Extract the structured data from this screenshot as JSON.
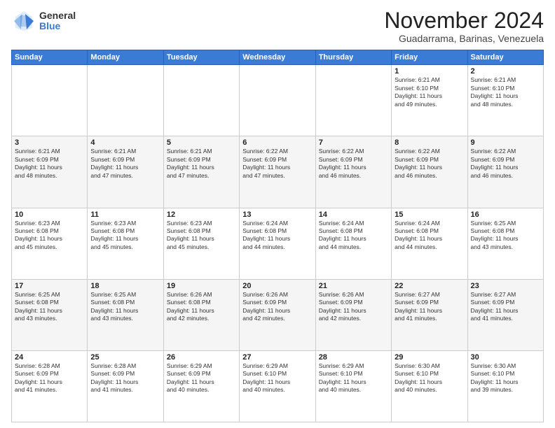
{
  "logo": {
    "general": "General",
    "blue": "Blue"
  },
  "title": "November 2024",
  "location": "Guadarrama, Barinas, Venezuela",
  "days_header": [
    "Sunday",
    "Monday",
    "Tuesday",
    "Wednesday",
    "Thursday",
    "Friday",
    "Saturday"
  ],
  "weeks": [
    [
      {
        "day": "",
        "info": ""
      },
      {
        "day": "",
        "info": ""
      },
      {
        "day": "",
        "info": ""
      },
      {
        "day": "",
        "info": ""
      },
      {
        "day": "",
        "info": ""
      },
      {
        "day": "1",
        "info": "Sunrise: 6:21 AM\nSunset: 6:10 PM\nDaylight: 11 hours\nand 49 minutes."
      },
      {
        "day": "2",
        "info": "Sunrise: 6:21 AM\nSunset: 6:10 PM\nDaylight: 11 hours\nand 48 minutes."
      }
    ],
    [
      {
        "day": "3",
        "info": "Sunrise: 6:21 AM\nSunset: 6:09 PM\nDaylight: 11 hours\nand 48 minutes."
      },
      {
        "day": "4",
        "info": "Sunrise: 6:21 AM\nSunset: 6:09 PM\nDaylight: 11 hours\nand 47 minutes."
      },
      {
        "day": "5",
        "info": "Sunrise: 6:21 AM\nSunset: 6:09 PM\nDaylight: 11 hours\nand 47 minutes."
      },
      {
        "day": "6",
        "info": "Sunrise: 6:22 AM\nSunset: 6:09 PM\nDaylight: 11 hours\nand 47 minutes."
      },
      {
        "day": "7",
        "info": "Sunrise: 6:22 AM\nSunset: 6:09 PM\nDaylight: 11 hours\nand 46 minutes."
      },
      {
        "day": "8",
        "info": "Sunrise: 6:22 AM\nSunset: 6:09 PM\nDaylight: 11 hours\nand 46 minutes."
      },
      {
        "day": "9",
        "info": "Sunrise: 6:22 AM\nSunset: 6:09 PM\nDaylight: 11 hours\nand 46 minutes."
      }
    ],
    [
      {
        "day": "10",
        "info": "Sunrise: 6:23 AM\nSunset: 6:08 PM\nDaylight: 11 hours\nand 45 minutes."
      },
      {
        "day": "11",
        "info": "Sunrise: 6:23 AM\nSunset: 6:08 PM\nDaylight: 11 hours\nand 45 minutes."
      },
      {
        "day": "12",
        "info": "Sunrise: 6:23 AM\nSunset: 6:08 PM\nDaylight: 11 hours\nand 45 minutes."
      },
      {
        "day": "13",
        "info": "Sunrise: 6:24 AM\nSunset: 6:08 PM\nDaylight: 11 hours\nand 44 minutes."
      },
      {
        "day": "14",
        "info": "Sunrise: 6:24 AM\nSunset: 6:08 PM\nDaylight: 11 hours\nand 44 minutes."
      },
      {
        "day": "15",
        "info": "Sunrise: 6:24 AM\nSunset: 6:08 PM\nDaylight: 11 hours\nand 44 minutes."
      },
      {
        "day": "16",
        "info": "Sunrise: 6:25 AM\nSunset: 6:08 PM\nDaylight: 11 hours\nand 43 minutes."
      }
    ],
    [
      {
        "day": "17",
        "info": "Sunrise: 6:25 AM\nSunset: 6:08 PM\nDaylight: 11 hours\nand 43 minutes."
      },
      {
        "day": "18",
        "info": "Sunrise: 6:25 AM\nSunset: 6:08 PM\nDaylight: 11 hours\nand 43 minutes."
      },
      {
        "day": "19",
        "info": "Sunrise: 6:26 AM\nSunset: 6:08 PM\nDaylight: 11 hours\nand 42 minutes."
      },
      {
        "day": "20",
        "info": "Sunrise: 6:26 AM\nSunset: 6:09 PM\nDaylight: 11 hours\nand 42 minutes."
      },
      {
        "day": "21",
        "info": "Sunrise: 6:26 AM\nSunset: 6:09 PM\nDaylight: 11 hours\nand 42 minutes."
      },
      {
        "day": "22",
        "info": "Sunrise: 6:27 AM\nSunset: 6:09 PM\nDaylight: 11 hours\nand 41 minutes."
      },
      {
        "day": "23",
        "info": "Sunrise: 6:27 AM\nSunset: 6:09 PM\nDaylight: 11 hours\nand 41 minutes."
      }
    ],
    [
      {
        "day": "24",
        "info": "Sunrise: 6:28 AM\nSunset: 6:09 PM\nDaylight: 11 hours\nand 41 minutes."
      },
      {
        "day": "25",
        "info": "Sunrise: 6:28 AM\nSunset: 6:09 PM\nDaylight: 11 hours\nand 41 minutes."
      },
      {
        "day": "26",
        "info": "Sunrise: 6:29 AM\nSunset: 6:09 PM\nDaylight: 11 hours\nand 40 minutes."
      },
      {
        "day": "27",
        "info": "Sunrise: 6:29 AM\nSunset: 6:10 PM\nDaylight: 11 hours\nand 40 minutes."
      },
      {
        "day": "28",
        "info": "Sunrise: 6:29 AM\nSunset: 6:10 PM\nDaylight: 11 hours\nand 40 minutes."
      },
      {
        "day": "29",
        "info": "Sunrise: 6:30 AM\nSunset: 6:10 PM\nDaylight: 11 hours\nand 40 minutes."
      },
      {
        "day": "30",
        "info": "Sunrise: 6:30 AM\nSunset: 6:10 PM\nDaylight: 11 hours\nand 39 minutes."
      }
    ]
  ]
}
